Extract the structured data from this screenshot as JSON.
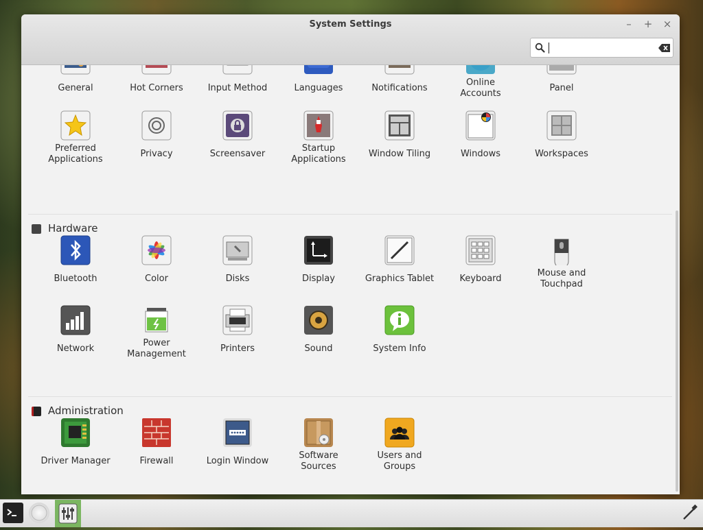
{
  "window": {
    "title": "System Settings"
  },
  "controls": {
    "minimize": "–",
    "maximize": "+",
    "close": "×"
  },
  "search": {
    "value": "",
    "placeholder": ""
  },
  "top_row": [
    {
      "id": "general",
      "label": "General",
      "icon": "general-icon"
    },
    {
      "id": "hot-corners",
      "label": "Hot Corners",
      "icon": "hot-corners-icon"
    },
    {
      "id": "input-method",
      "label": "Input Method",
      "icon": "input-method-icon"
    },
    {
      "id": "languages",
      "label": "Languages",
      "icon": "languages-icon"
    },
    {
      "id": "notifications",
      "label": "Notifications",
      "icon": "notifications-icon"
    },
    {
      "id": "online-accounts",
      "label": "Online\nAccounts",
      "icon": "online-accounts-icon"
    },
    {
      "id": "panel",
      "label": "Panel",
      "icon": "panel-icon"
    }
  ],
  "prefs_row": [
    {
      "id": "preferred-applications",
      "label": "Preferred\nApplications",
      "icon": "star-icon"
    },
    {
      "id": "privacy",
      "label": "Privacy",
      "icon": "privacy-icon"
    },
    {
      "id": "screensaver",
      "label": "Screensaver",
      "icon": "lock-icon"
    },
    {
      "id": "startup-applications",
      "label": "Startup\nApplications",
      "icon": "rocket-icon"
    },
    {
      "id": "window-tiling",
      "label": "Window Tiling",
      "icon": "window-tiling-icon"
    },
    {
      "id": "windows",
      "label": "Windows",
      "icon": "windows-icon"
    },
    {
      "id": "workspaces",
      "label": "Workspaces",
      "icon": "workspaces-icon"
    }
  ],
  "hardware": {
    "title": "Hardware",
    "row1": [
      {
        "id": "bluetooth",
        "label": "Bluetooth",
        "icon": "bluetooth-icon"
      },
      {
        "id": "color",
        "label": "Color",
        "icon": "color-icon"
      },
      {
        "id": "disks",
        "label": "Disks",
        "icon": "disks-icon"
      },
      {
        "id": "display",
        "label": "Display",
        "icon": "display-icon"
      },
      {
        "id": "graphics-tablet",
        "label": "Graphics Tablet",
        "icon": "graphics-tablet-icon"
      },
      {
        "id": "keyboard",
        "label": "Keyboard",
        "icon": "keyboard-icon"
      },
      {
        "id": "mouse-touchpad",
        "label": "Mouse and\nTouchpad",
        "icon": "mouse-icon"
      }
    ],
    "row2": [
      {
        "id": "network",
        "label": "Network",
        "icon": "network-icon"
      },
      {
        "id": "power-management",
        "label": "Power\nManagement",
        "icon": "battery-icon"
      },
      {
        "id": "printers",
        "label": "Printers",
        "icon": "printer-icon"
      },
      {
        "id": "sound",
        "label": "Sound",
        "icon": "speaker-icon"
      },
      {
        "id": "system-info",
        "label": "System Info",
        "icon": "info-icon"
      }
    ]
  },
  "administration": {
    "title": "Administration",
    "row1": [
      {
        "id": "driver-manager",
        "label": "Driver Manager",
        "icon": "driver-icon"
      },
      {
        "id": "firewall",
        "label": "Firewall",
        "icon": "firewall-icon"
      },
      {
        "id": "login-window",
        "label": "Login Window",
        "icon": "login-window-icon"
      },
      {
        "id": "software-sources",
        "label": "Software\nSources",
        "icon": "package-icon"
      },
      {
        "id": "users-groups",
        "label": "Users and\nGroups",
        "icon": "users-icon"
      }
    ]
  },
  "colors": {
    "accent": "#4a8f2e",
    "window_bg": "#f2f2f2"
  }
}
